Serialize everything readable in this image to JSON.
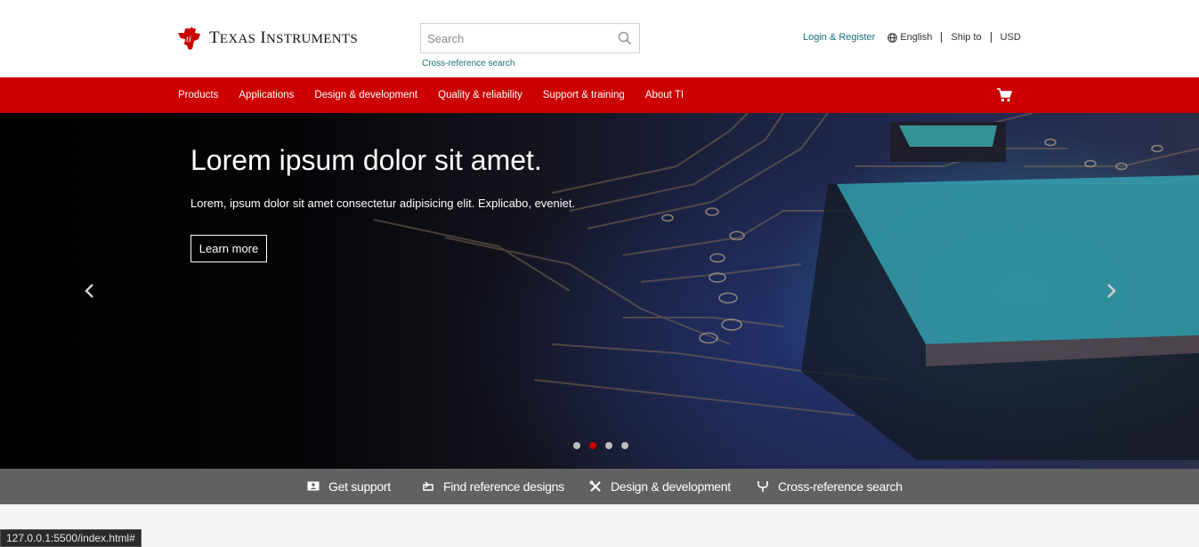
{
  "header": {
    "logo_text_big_1": "T",
    "logo_text_sm_1": "EXAS",
    "logo_text_big_2": "I",
    "logo_text_sm_2": "NSTRUMENTS",
    "search_placeholder": "Search",
    "cross_reference_link": "Cross-reference search",
    "login_label": "Login & Register",
    "language_label": "English",
    "ship_to_label": "Ship to",
    "currency_label": "USD"
  },
  "nav": {
    "items": [
      "Products",
      "Applications",
      "Design & development",
      "Quality & reliability",
      "Support & training",
      "About TI"
    ]
  },
  "hero": {
    "title": "Lorem ipsum dolor sit amet.",
    "subtitle": "Lorem, ipsum dolor sit amet consectetur adipisicing elit. Explicabo, eveniet.",
    "button_label": "Learn more",
    "slide_count": 4,
    "active_slide": 2
  },
  "quickbar": {
    "items": [
      {
        "label": "Get support",
        "icon": "support-icon"
      },
      {
        "label": "Find reference designs",
        "icon": "reference-designs-icon"
      },
      {
        "label": "Design & development",
        "icon": "tools-icon"
      },
      {
        "label": "Cross-reference search",
        "icon": "cross-reference-icon"
      }
    ]
  },
  "status_bar": {
    "url": "127.0.0.1:5500/index.html#"
  },
  "colors": {
    "brand_red": "#cc0000",
    "link_teal": "#1a6c7a",
    "quickbar_gray": "#616161"
  }
}
